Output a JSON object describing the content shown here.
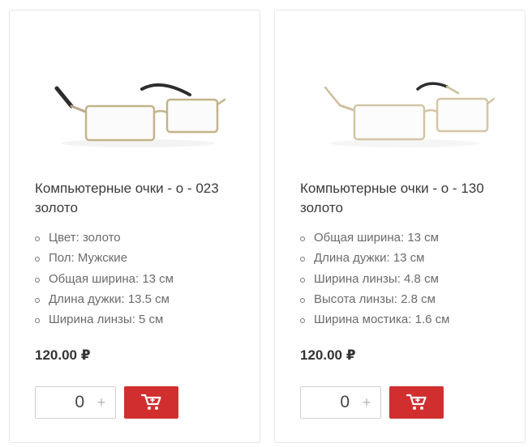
{
  "products": [
    {
      "title": "Компьютерные очки - о - 023 золото",
      "specs": [
        "Цвет: золото",
        "Пол: Мужские",
        "Общая ширина: 13 см",
        "Длина дужки: 13.5 см",
        "Ширина линзы: 5 см"
      ],
      "price": "120.00 ₽",
      "quantity": "0",
      "plus_label": "+",
      "image_icon": "eyeglasses-gold-dark-temples",
      "cart_icon": "shopping-cart-icon"
    },
    {
      "title": "Компьютерные очки - о - 130 золото",
      "specs": [
        "Общая ширина: 13 см",
        "Длина дужки: 13 см",
        "Ширина линзы: 4.8 см",
        "Высота линзы: 2.8 см",
        "Ширина мостика: 1.6 см"
      ],
      "price": "120.00 ₽",
      "quantity": "0",
      "plus_label": "+",
      "image_icon": "eyeglasses-gold-light",
      "cart_icon": "shopping-cart-icon"
    }
  ],
  "colors": {
    "accent": "#d12f2f",
    "frame_gold": "#c9b78a",
    "temple_dark": "#2b2b2b"
  }
}
